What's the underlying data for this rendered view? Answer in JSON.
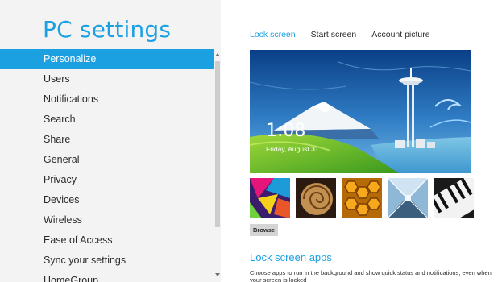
{
  "app": {
    "title": "PC settings"
  },
  "nav": {
    "items": [
      {
        "label": "Personalize",
        "selected": true
      },
      {
        "label": "Users"
      },
      {
        "label": "Notifications"
      },
      {
        "label": "Search"
      },
      {
        "label": "Share"
      },
      {
        "label": "General"
      },
      {
        "label": "Privacy"
      },
      {
        "label": "Devices"
      },
      {
        "label": "Wireless"
      },
      {
        "label": "Ease of Access"
      },
      {
        "label": "Sync your settings"
      },
      {
        "label": "HomeGroup"
      }
    ]
  },
  "tabs": [
    {
      "label": "Lock screen",
      "active": true
    },
    {
      "label": "Start screen"
    },
    {
      "label": "Account picture"
    }
  ],
  "lock_preview": {
    "time": "1:08",
    "date": "Friday, August 31"
  },
  "thumbnails": [
    "colorful-geometric",
    "nautilus-shell",
    "honeycomb",
    "glass-corridor",
    "piano-keys"
  ],
  "browse_label": "Browse",
  "lock_apps": {
    "title": "Lock screen apps",
    "description": "Choose apps to run in the background and show quick status and notifications, even when your screen is locked"
  },
  "colors": {
    "accent": "#1ba1e2",
    "left_bg": "#f3f3f3"
  }
}
